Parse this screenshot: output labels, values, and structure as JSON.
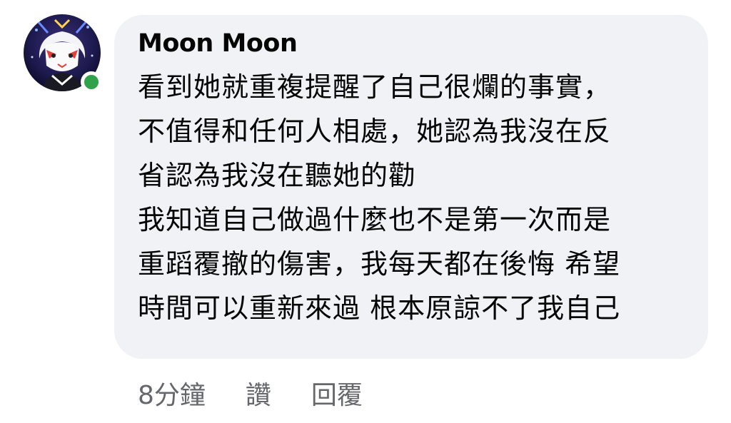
{
  "comment": {
    "author": "Moon Moon",
    "lines": [
      "看到她就重複提醒了自己很爛的事實，",
      "不值得和任何人相處，她認為我沒在反",
      "省認為我沒在聽她的勸",
      "我知道自己做過什麼也不是第一次而是",
      "重蹈覆撤的傷害，我每天都在後悔 希望",
      "時間可以重新來過 根本原諒不了我自己"
    ],
    "time": "8分鐘",
    "like_label": "讚",
    "reply_label": "回覆"
  },
  "avatar": {
    "icon": "profile-avatar",
    "status": "online",
    "status_color": "#31a24c"
  },
  "colors": {
    "bubble_bg": "#f0f2f5",
    "text": "#050505",
    "meta": "#65676b"
  }
}
